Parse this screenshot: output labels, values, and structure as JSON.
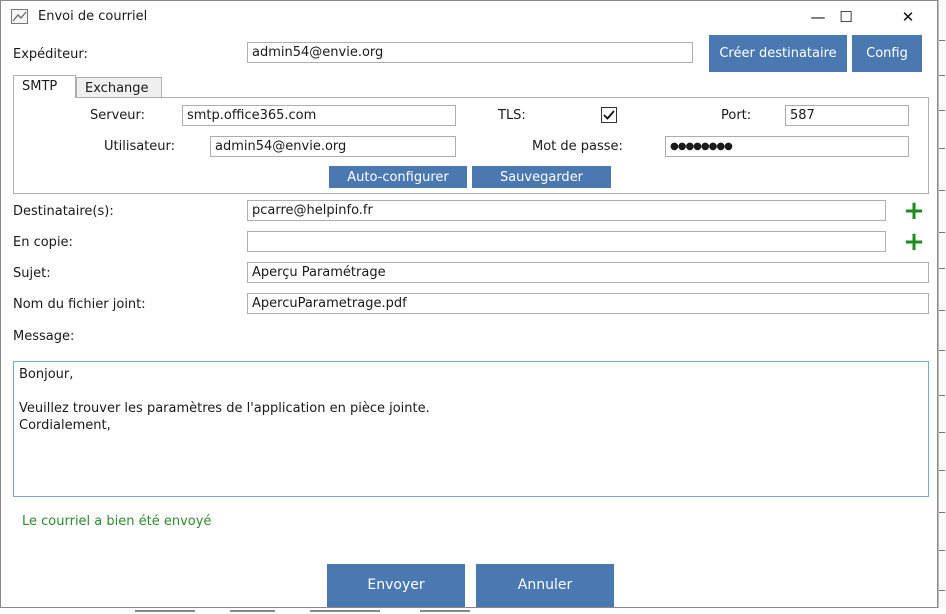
{
  "window": {
    "title": "Envoi de courriel",
    "minimize": "—",
    "maximize": "☐",
    "close": "✕"
  },
  "sender": {
    "label": "Expéditeur:",
    "value": "admin54@envie.org"
  },
  "buttons": {
    "create_recipient": "Créer destinataire",
    "config": "Config",
    "auto_configure": "Auto-configurer",
    "save": "Sauvegarder",
    "send": "Envoyer",
    "cancel": "Annuler"
  },
  "tabs": [
    {
      "label": "SMTP"
    },
    {
      "label": "Exchange"
    }
  ],
  "smtp": {
    "server_label": "Serveur:",
    "server_value": "smtp.office365.com",
    "tls_label": "TLS:",
    "tls_checked": true,
    "port_label": "Port:",
    "port_value": "587",
    "user_label": "Utilisateur:",
    "user_value": "admin54@envie.org",
    "password_label": "Mot de passe:",
    "password_value": "●●●●●●●●"
  },
  "recipients": {
    "label": "Destinataire(s):",
    "value": "pcarre@helpinfo.fr"
  },
  "cc": {
    "label": "En copie:",
    "value": ""
  },
  "subject": {
    "label": "Sujet:",
    "value": "Aperçu Paramétrage"
  },
  "attachment": {
    "label": "Nom du fichier joint:",
    "value": "ApercuParametrage.pdf"
  },
  "message": {
    "label": "Message:",
    "value": "Bonjour,\n\nVeuillez trouver les paramètres de l'application en pièce jointe.\nCordialement,"
  },
  "status": {
    "text": "Le courriel a bien été envoyé",
    "color": "#2f8a2f"
  },
  "colors": {
    "accent_button": "#4a78b0",
    "add_icon": "#1f8a1f"
  },
  "icons": {
    "add": "plus-icon",
    "checkbox": "check-icon",
    "app": "mail-window-icon"
  }
}
